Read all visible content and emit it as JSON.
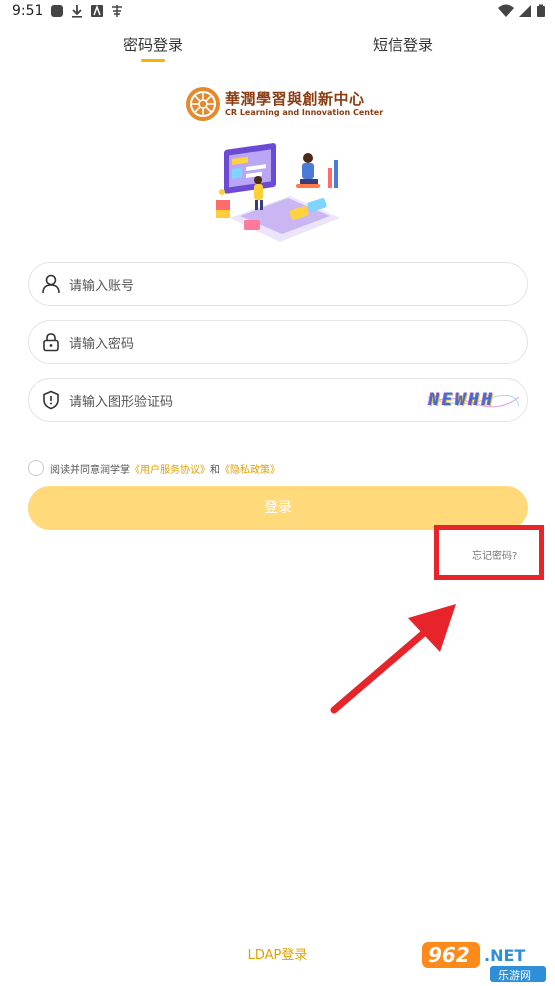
{
  "status_bar": {
    "time": "9:51"
  },
  "tabs": [
    {
      "label": "密码登录",
      "active": true
    },
    {
      "label": "短信登录",
      "active": false
    }
  ],
  "logo": {
    "title": "華潤學習與創新中心",
    "subtitle": "CR Learning and Innovation Center"
  },
  "form": {
    "account_placeholder": "请输入账号",
    "password_placeholder": "请输入密码",
    "captcha_placeholder": "请输入图形验证码",
    "captcha_text": "NEWHH"
  },
  "agreement": {
    "prefix": "阅读并同意润学掌",
    "user_agreement": "《用户服务协议》",
    "conj": "和",
    "privacy": "《隐私政策》"
  },
  "login_button": "登录",
  "forgot_password": "忘记密码?",
  "ldap_login": "LDAP登录",
  "watermark": {
    "number": "962",
    "suffix": ".NET",
    "caption": "乐游网"
  },
  "colors": {
    "accent": "#f5b400",
    "button": "#ffd97a",
    "highlight": "#e8242b"
  }
}
